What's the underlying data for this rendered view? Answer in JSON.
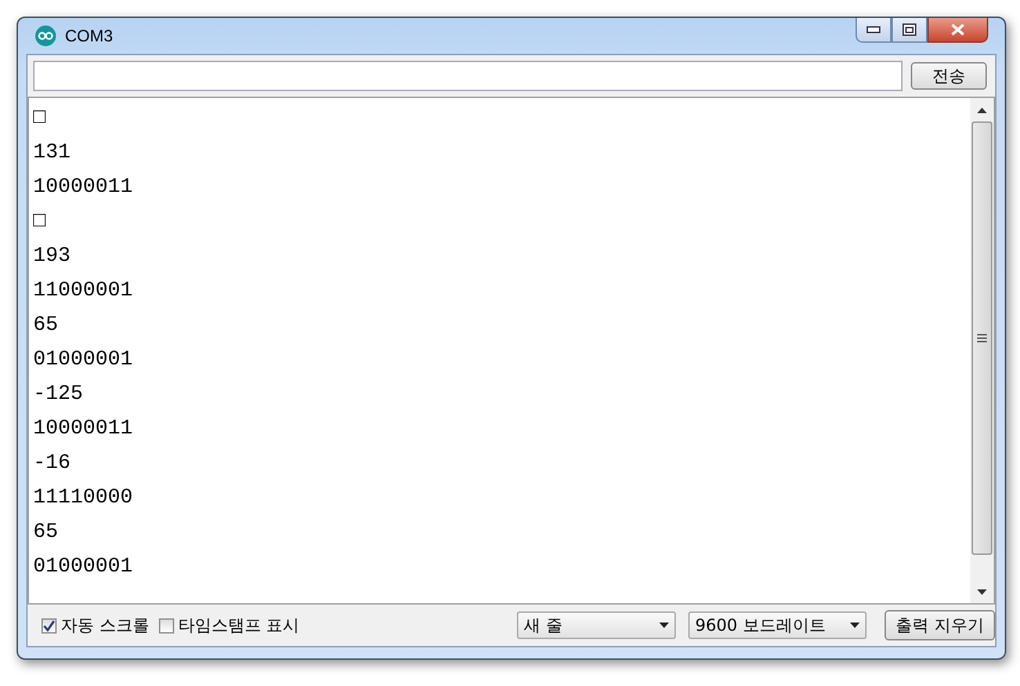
{
  "window": {
    "title": "COM3"
  },
  "send_button": "전송",
  "output_lines": [
    "□",
    "131",
    "10000011",
    "□",
    "193",
    "11000001",
    "65",
    "01000001",
    "-125",
    "10000011",
    "-16",
    "11110000",
    "65",
    "01000001"
  ],
  "footer": {
    "checkboxes": [
      {
        "label": "자동 스크롤",
        "checked": true
      },
      {
        "label": "타임스탬프 표시",
        "checked": false
      }
    ],
    "dropdowns": [
      "새 줄",
      "9600 보드레이트"
    ],
    "clear_button": "출력 지우기"
  }
}
